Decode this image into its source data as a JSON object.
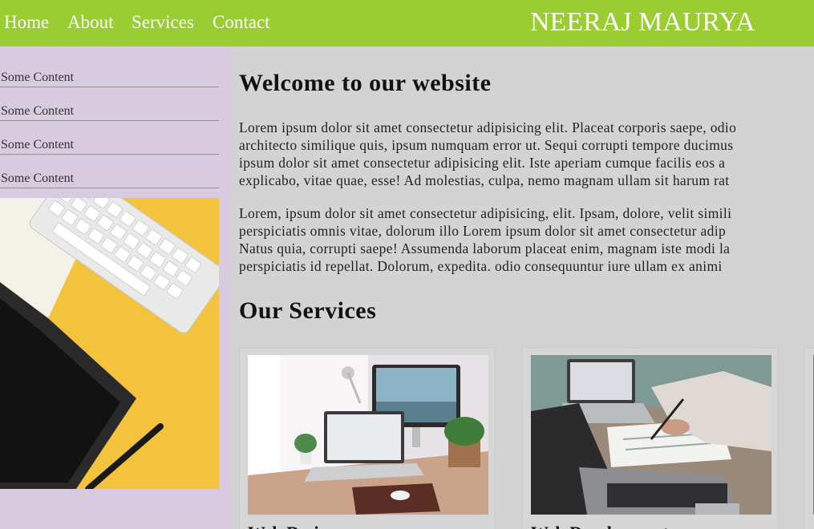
{
  "nav": {
    "items": [
      {
        "label": "Home"
      },
      {
        "label": "About"
      },
      {
        "label": "Services"
      },
      {
        "label": "Contact"
      }
    ],
    "brand": "NEERAJ MAURYA"
  },
  "sidebar": {
    "items": [
      {
        "label": "Some Content"
      },
      {
        "label": "Some Content"
      },
      {
        "label": "Some Content"
      },
      {
        "label": "Some Content"
      }
    ]
  },
  "main": {
    "heading": "Welcome to our website",
    "para1": [
      "Lorem ipsum dolor sit amet consectetur adipisicing elit. Placeat corporis saepe, odio",
      "architecto similique quis, ipsum numquam error ut. Sequi corrupti tempore ducimus",
      "ipsum dolor sit amet consectetur adipisicing elit. Iste aperiam cumque facilis eos a",
      "explicabo, vitae quae, esse! Ad molestias, culpa, nemo magnam ullam sit harum rat"
    ],
    "para2": [
      "Lorem, ipsum dolor sit amet consectetur adipisicing, elit. Ipsam, dolore, velit simili",
      "perspiciatis omnis vitae, dolorum illo Lorem ipsum dolor sit amet consectetur adip",
      "Natus quia, corrupti saepe! Assumenda laborum placeat enim, magnam iste modi la",
      "perspiciatis id repellat. Dolorum, expedita. odio consequuntur iure ullam ex animi"
    ],
    "services_heading": "Our Services",
    "cards": [
      {
        "title": "Web Design"
      },
      {
        "title": "Web Development"
      }
    ]
  }
}
